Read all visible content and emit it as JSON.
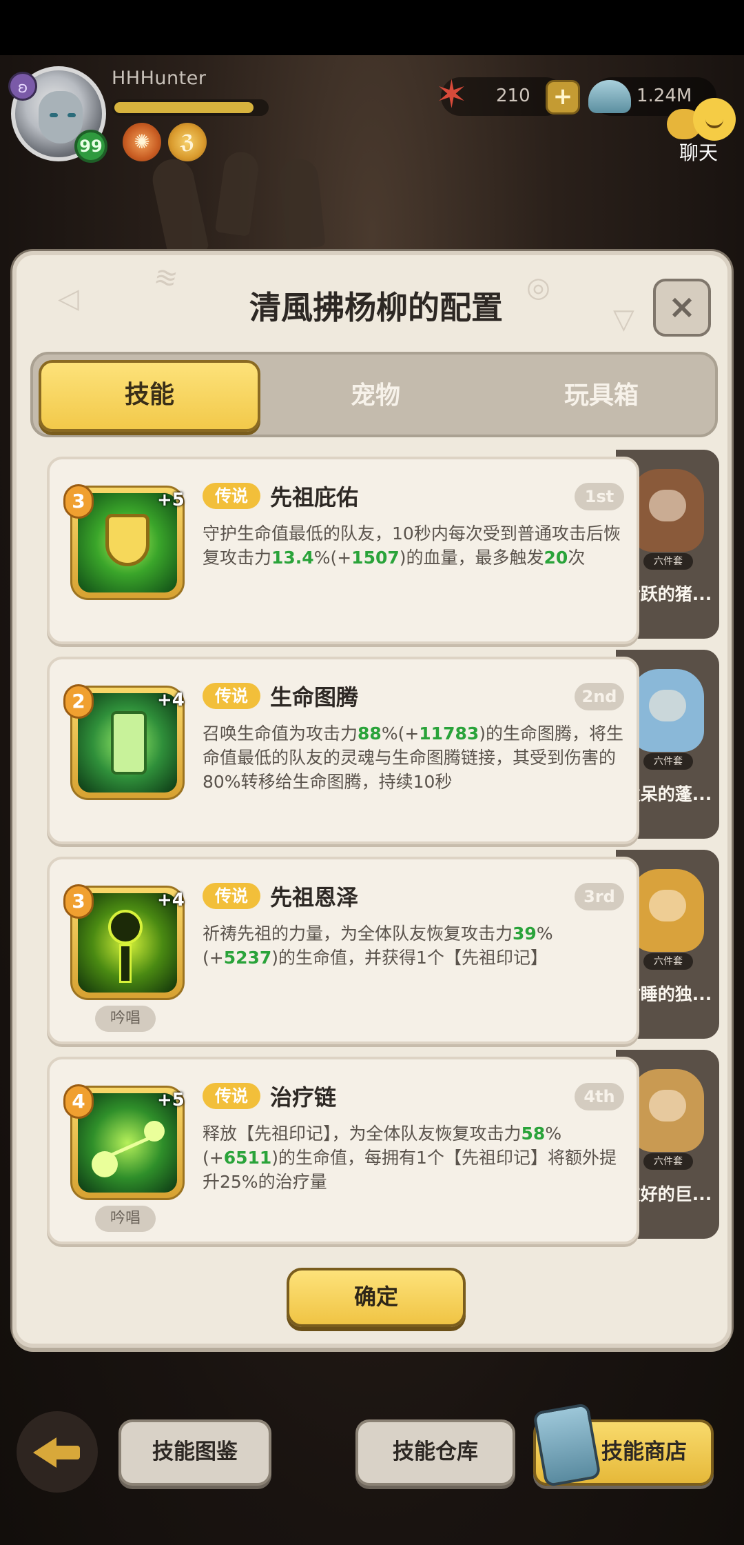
{
  "player": {
    "name": "HHHunter",
    "level": "99",
    "xp_fraction": 0.92
  },
  "resources": {
    "starfish": "210",
    "shells": "1.24M"
  },
  "chat": {
    "label": "聊天"
  },
  "dialog": {
    "title": "清風拂杨柳的配置",
    "close": "×",
    "tabs": [
      {
        "label": "技能",
        "active": true
      },
      {
        "label": "宠物",
        "active": false
      },
      {
        "label": "玩具箱",
        "active": false
      }
    ],
    "skills": [
      {
        "level": "3",
        "bonus": "+5",
        "rarity": "传说",
        "name": "先祖庇佑",
        "rank": "1st",
        "chant": "",
        "desc": [
          "守护生命值最低的队友，10秒内每次受到普通攻击后恢复攻击力",
          "13.4",
          "%(+",
          "1507",
          ")的血量，最多触发",
          "20",
          "次"
        ]
      },
      {
        "level": "2",
        "bonus": "+4",
        "rarity": "传说",
        "name": "生命图腾",
        "rank": "2nd",
        "chant": "",
        "desc": [
          "召唤生命值为攻击力",
          "88",
          "%(+",
          "11783",
          ")的生命图腾，将生命值最低的队友的灵魂与生命图腾链接，其受到伤害的80%转移给生命图腾，持续10秒",
          "",
          "",
          "",
          ""
        ]
      },
      {
        "level": "3",
        "bonus": "+4",
        "rarity": "传说",
        "name": "先祖恩泽",
        "rank": "3rd",
        "chant": "吟唱",
        "desc": [
          "祈祷先祖的力量，为全体队友恢复攻击力",
          "39",
          "%(+",
          "5237",
          ")的生命值，并获得1个【先祖印记】",
          "",
          ""
        ]
      },
      {
        "level": "4",
        "bonus": "+5",
        "rarity": "传说",
        "name": "治疗链",
        "rank": "4th",
        "chant": "吟唱",
        "desc": [
          "释放【先祖印记】，为全体队友恢复攻击力",
          "58",
          "%(+",
          "6511",
          ")的生命值，每拥有1个【先祖印记】将额外提升25%的治疗量",
          "",
          ""
        ]
      }
    ],
    "pets": [
      {
        "tag": "六件套",
        "name": "活跃的猪...",
        "color": "#8a5a3a"
      },
      {
        "tag": "六件套",
        "name": "发呆的蓬...",
        "color": "#8ab8d8"
      },
      {
        "tag": "六件套",
        "name": "酣睡的独...",
        "color": "#d9a23c"
      },
      {
        "tag": "六件套",
        "name": "友好的巨...",
        "color": "#c99a52"
      }
    ],
    "confirm": "确定"
  },
  "bottom_bar": {
    "codex": "技能图鉴",
    "storage": "技能仓库",
    "shop": "技能商店"
  },
  "colors": {
    "accent_yellow": "#f2c94a",
    "highlight_green": "#2aa33a",
    "rarity_legend": "#f2bf3a"
  }
}
